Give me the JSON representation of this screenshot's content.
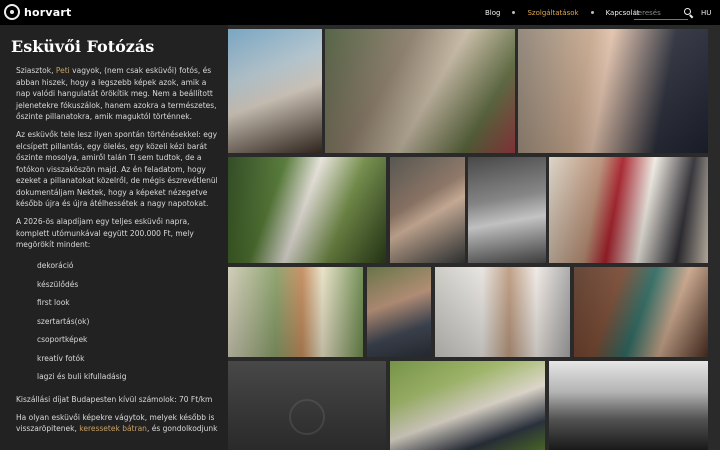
{
  "header": {
    "logo_text": "horvart",
    "nav": [
      {
        "label": "Blog"
      },
      {
        "label": "Szolgáltatások"
      },
      {
        "label": "Kapcsolat"
      }
    ],
    "active_nav": "Szolgáltatások",
    "search_placeholder": "keresés",
    "lang": "HU",
    "colors": {
      "accent": "#e0a94a",
      "link": "#c8a165"
    }
  },
  "content": {
    "title": "Esküvői Fotózás",
    "intro_1": "Sziasztok, ",
    "intro_name": "Peti",
    "intro_2": " vagyok, (nem csak esküvői) fotós, és abban hiszek, hogy a legszebb képek azok, amik a nap valódi hangulatát örökítik meg. Nem a beállított jelenetekre fókuszálok, hanem azokra a természetes, őszinte pillanatokra, amik maguktól történnek.",
    "para_2": "Az esküvők tele lesz ilyen spontán történésekkel: egy elcsípett pillantás, egy ölelés, egy közeli kézi barát őszinte mosolya, amiről talán Ti sem tudtok, de a fotókon visszaköszön majd. Az én feladatom, hogy ezeket a pillanatokat közelről, de mégis észrevétlenül dokumentáljam Nektek, hogy a képeket nézegetve később újra és újra átélhessétek a nagy napotokat.",
    "para_3": "A 2026-ös alapdíjam egy teljes esküvői napra, komplett utómunkával együtt 200.000 Ft, mely megörökít mindent:",
    "list": [
      "dekoráció",
      "készülődés",
      "first look",
      "szertartás(ok)",
      "csoportképek",
      "kreatív fotók",
      "lagzi és buli kifulladásig"
    ],
    "travel": "Kiszállási díjat Budapesten kívül számolok: 70 Ft/km",
    "outro_1": "Ha olyan esküvői képekre vágytok, melyek később is visszaröpitenek, ",
    "outro_link": "keressetek bátran",
    "outro_2": ", és gondolkodjunk"
  }
}
